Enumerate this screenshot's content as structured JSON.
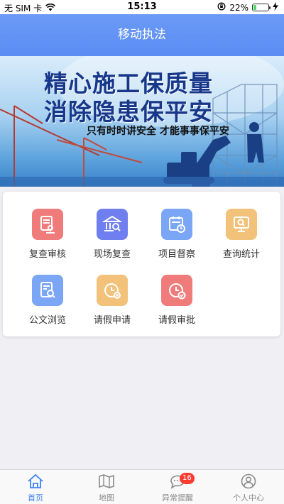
{
  "status_bar": {
    "carrier": "无 SIM 卡",
    "time": "15:13",
    "battery": "22%",
    "battery_level": 0.22
  },
  "header": {
    "title": "移动执法"
  },
  "banner": {
    "line1": "精心施工保质量",
    "line2": "消除隐患保平安",
    "slogan": "只有时时讲安全  才能事事保平安"
  },
  "menu": [
    {
      "label": "复查审核",
      "icon": "review-icon",
      "color": "#f07b7b"
    },
    {
      "label": "现场复查",
      "icon": "site-inspection-icon",
      "color": "#6f7ff0"
    },
    {
      "label": "项目督察",
      "icon": "project-calendar-icon",
      "color": "#7aa6f5"
    },
    {
      "label": "查询统计",
      "icon": "query-stats-icon",
      "color": "#f2c27a"
    },
    {
      "label": "公文浏览",
      "icon": "document-browse-icon",
      "color": "#7aa6f5"
    },
    {
      "label": "请假申请",
      "icon": "leave-apply-icon",
      "color": "#f2c27a"
    },
    {
      "label": "请假审批",
      "icon": "leave-approve-icon",
      "color": "#f07b7b"
    }
  ],
  "tabs": [
    {
      "label": "首页",
      "icon": "home-icon",
      "active": true
    },
    {
      "label": "地图",
      "icon": "map-icon",
      "active": false
    },
    {
      "label": "异常提醒",
      "icon": "message-icon",
      "active": false,
      "badge": "16"
    },
    {
      "label": "个人中心",
      "icon": "user-icon",
      "active": false
    }
  ],
  "colors": {
    "header": "#5b8cf3",
    "tab_active": "#3e82f7",
    "tab_inactive": "#8a8a8a",
    "badge": "#ff3b30"
  }
}
